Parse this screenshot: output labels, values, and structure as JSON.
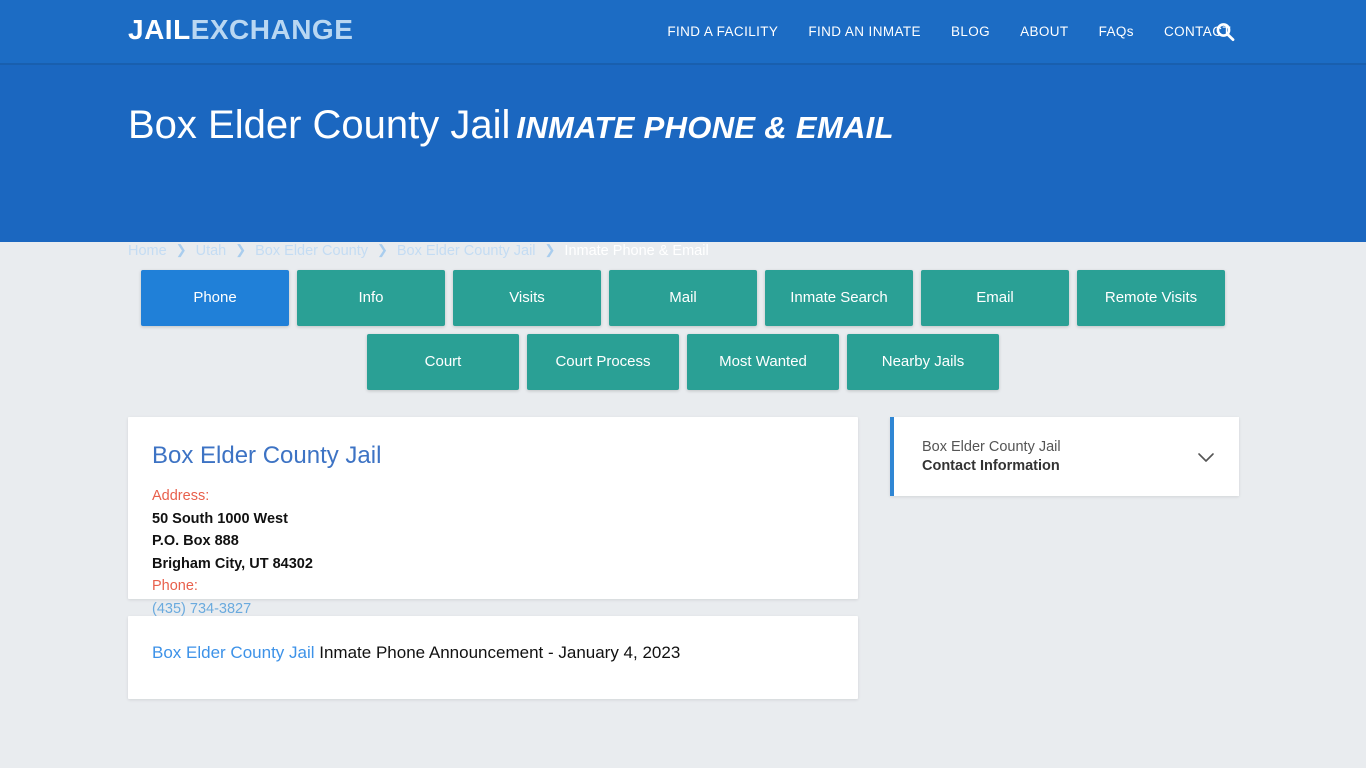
{
  "nav": {
    "logo_part1": "JAIL",
    "logo_part2": "EXCHANGE",
    "links": [
      {
        "label": "FIND A FACILITY"
      },
      {
        "label": "FIND AN INMATE"
      },
      {
        "label": "BLOG"
      },
      {
        "label": "ABOUT"
      },
      {
        "label": "FAQs"
      },
      {
        "label": "CONTACT"
      }
    ],
    "search_icon": "search-icon",
    "background": "#1c6cc4"
  },
  "hero": {
    "title_main": "Box Elder County Jail",
    "title_sub": "Inmate Phone & Email",
    "background": "#1b67c0",
    "breadcrumb": [
      {
        "label": "Home",
        "current": false
      },
      {
        "label": "Utah",
        "current": false
      },
      {
        "label": "Box Elder County",
        "current": false
      },
      {
        "label": "Box Elder County Jail",
        "current": false
      },
      {
        "label": "Inmate Phone & Email",
        "current": true
      }
    ]
  },
  "tabs": {
    "active_color": "#2080d8",
    "inactive_color": "#2aa095",
    "row1": [
      {
        "label": "Phone",
        "active": true
      },
      {
        "label": "Info",
        "active": false
      },
      {
        "label": "Visits",
        "active": false
      },
      {
        "label": "Mail",
        "active": false
      },
      {
        "label": "Inmate Search",
        "active": false
      },
      {
        "label": "Email",
        "active": false
      },
      {
        "label": "Remote Visits",
        "active": false
      }
    ],
    "row2": [
      {
        "label": "Court",
        "active": false
      },
      {
        "label": "Court Process",
        "active": false
      },
      {
        "label": "Most Wanted",
        "active": false
      },
      {
        "label": "Nearby Jails",
        "active": false
      }
    ]
  },
  "facility_card": {
    "title": "Box Elder County Jail",
    "address_label": "Address:",
    "address_line1": "50 South 1000 West",
    "address_line2": "P.O. Box 888",
    "address_line3": "Brigham City, UT 84302",
    "phone_label": "Phone:",
    "phone_value": "(435) 734-3827",
    "title_color": "#3d73c4",
    "label_color": "#e8604c",
    "phone_color": "#6aaade"
  },
  "announcement_card": {
    "link_text": "Box Elder County Jail",
    "rest_text": " Inmate Phone Announcement - January 4, 2023"
  },
  "sidebar": {
    "accordion": {
      "line1": "Box Elder County Jail",
      "line2": "Contact Information",
      "chevron_icon": "chevron-down-icon",
      "accent_color": "#2f86d4"
    }
  },
  "page": {
    "background": "#e9ecef"
  }
}
